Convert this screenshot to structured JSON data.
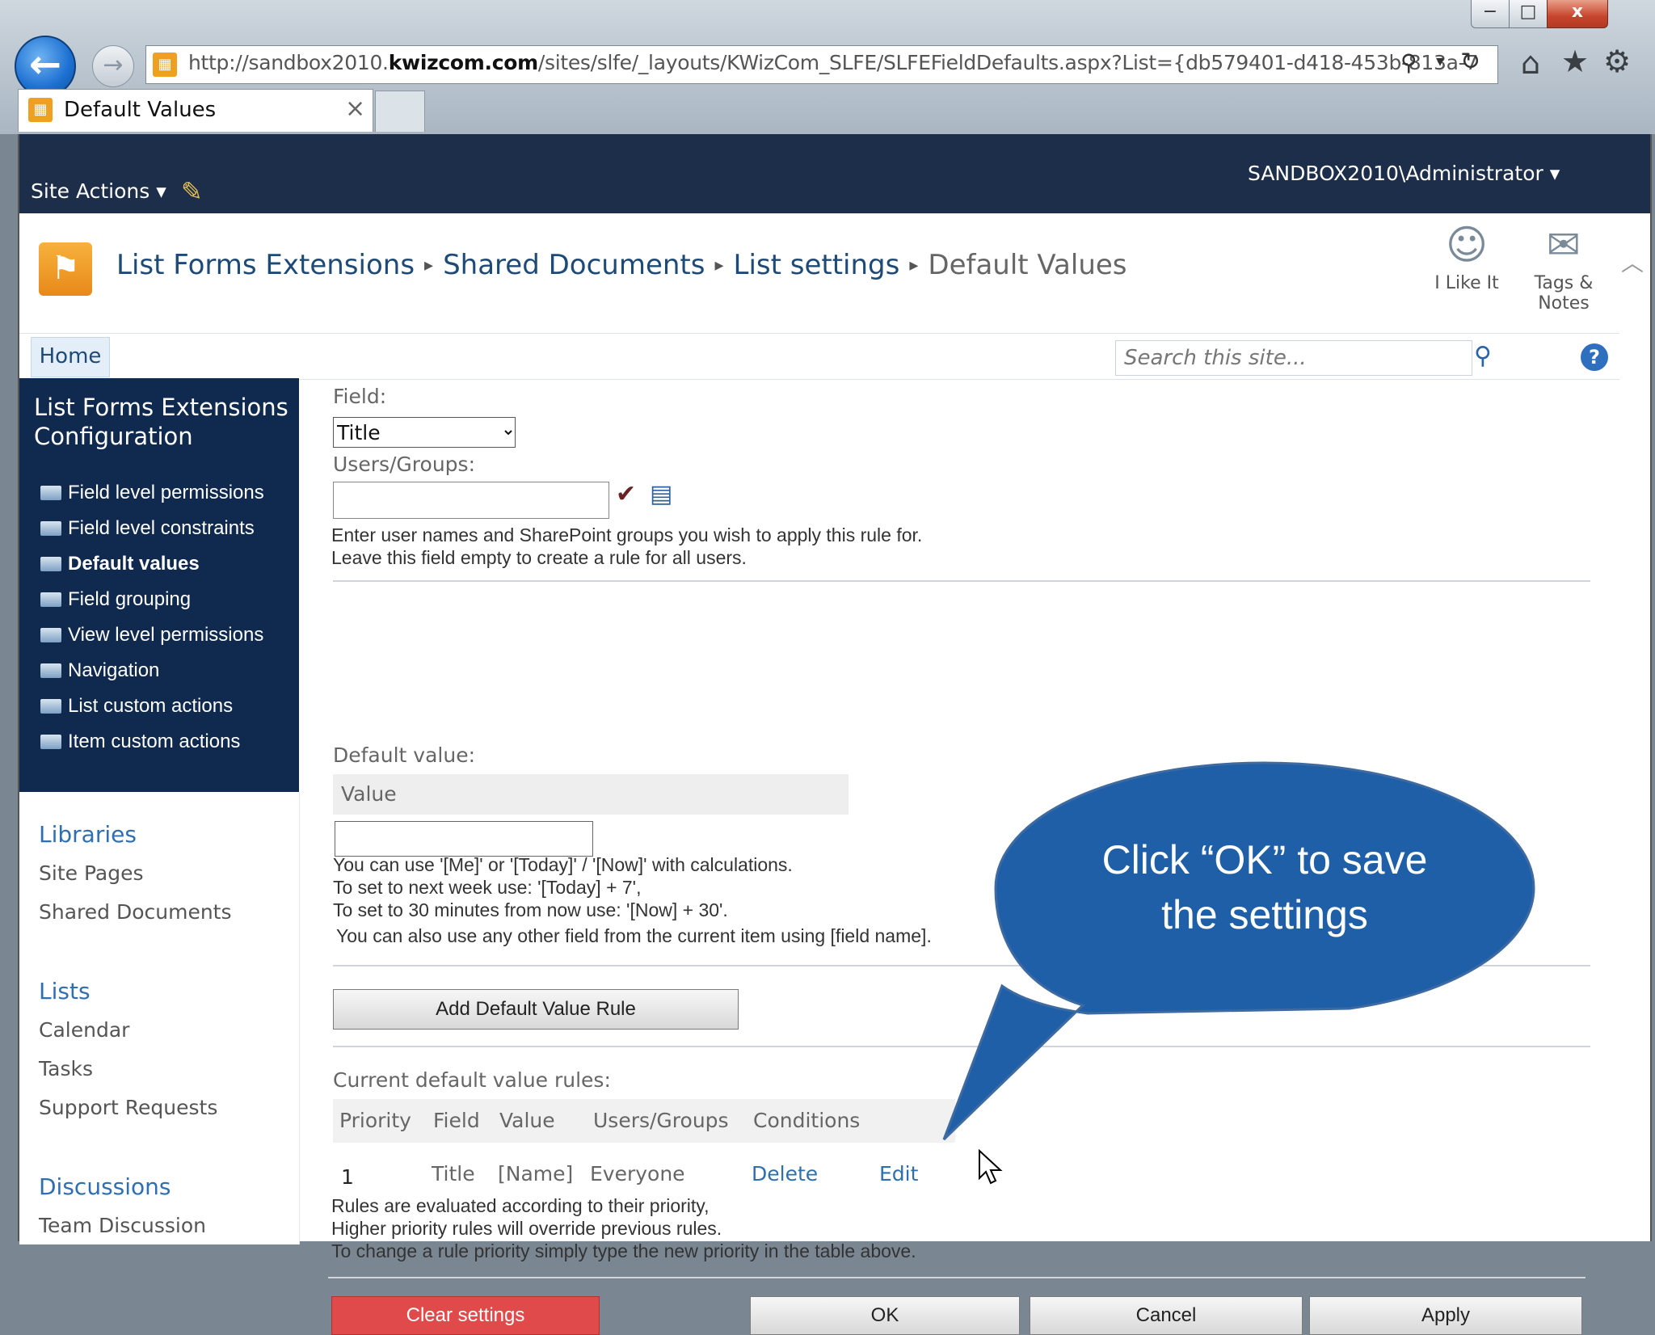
{
  "browser": {
    "url_prefix": "http://sandbox2010.",
    "url_domain": "kwizcom.com",
    "url_suffix": "/sites/slfe/_layouts/KWizCom_SLFE/SLFEFieldDefaults.aspx?List={db579401-d418-453b-813a-7",
    "tab_title": "Default Values",
    "close_glyph": "×",
    "win_min": "−",
    "win_max": "□",
    "win_close": "x"
  },
  "topbar": {
    "site_actions": "Site Actions ▾",
    "user": "SANDBOX2010\\Administrator ▾"
  },
  "breadcrumb": {
    "items": [
      "List Forms Extensions",
      "Shared Documents",
      "List settings",
      "Default Values"
    ]
  },
  "social": {
    "like": "I Like It",
    "tags": "Tags &",
    "notes": "Notes"
  },
  "nav": {
    "home": "Home",
    "search_placeholder": "Search this site..."
  },
  "leftnav": {
    "title": "List Forms Extensions Configuration",
    "items": [
      {
        "label": "Field level permissions"
      },
      {
        "label": "Field level constraints"
      },
      {
        "label": "Default values"
      },
      {
        "label": "Field grouping"
      },
      {
        "label": "View level permissions"
      },
      {
        "label": "Navigation"
      },
      {
        "label": "List custom actions"
      },
      {
        "label": "Item custom actions"
      }
    ],
    "libraries_head": "Libraries",
    "libraries": [
      "Site Pages",
      "Shared Documents"
    ],
    "lists_head": "Lists",
    "lists": [
      "Calendar",
      "Tasks",
      "Support Requests"
    ],
    "discussions_head": "Discussions",
    "discussions": [
      "Team Discussion"
    ]
  },
  "form": {
    "field_label": "Field:",
    "field_value": "Title",
    "users_label": "Users/Groups:",
    "users_help_1": "Enter user names and SharePoint groups you wish to apply this rule for.",
    "users_help_2": "Leave this field empty to create a rule for all users.",
    "default_value_label": "Default value:",
    "value_header": "Value",
    "value_help_1": "You can use '[Me]' or '[Today]' / '[Now]' with calculations.",
    "value_help_2": "To set to next week use: '[Today] + 7',",
    "value_help_3": "To set to 30 minutes from now use: '[Now] + 30'.",
    "value_help_4": "You can also use any other field from the current item using [field name].",
    "add_rule_button": "Add Default Value Rule",
    "current_rules_label": "Current default value rules:",
    "table_headers": [
      "Priority",
      "Field",
      "Value",
      "Users/Groups",
      "Conditions"
    ],
    "rule": {
      "priority": "1",
      "field": "Title",
      "value": "[Name]",
      "users": "Everyone",
      "delete": "Delete",
      "edit": "Edit"
    },
    "rules_help_1": "Rules are evaluated according to their priority,",
    "rules_help_2": "Higher priority rules will override previous rules.",
    "rules_help_3": "To change a rule priority simply type the new priority in the table above.",
    "clear_button": "Clear settings",
    "ok_button": "OK",
    "cancel_button": "Cancel",
    "apply_button": "Apply"
  },
  "callout": {
    "line1": "Click “OK” to save",
    "line2": "the settings",
    "color": "#1f5fa8"
  }
}
